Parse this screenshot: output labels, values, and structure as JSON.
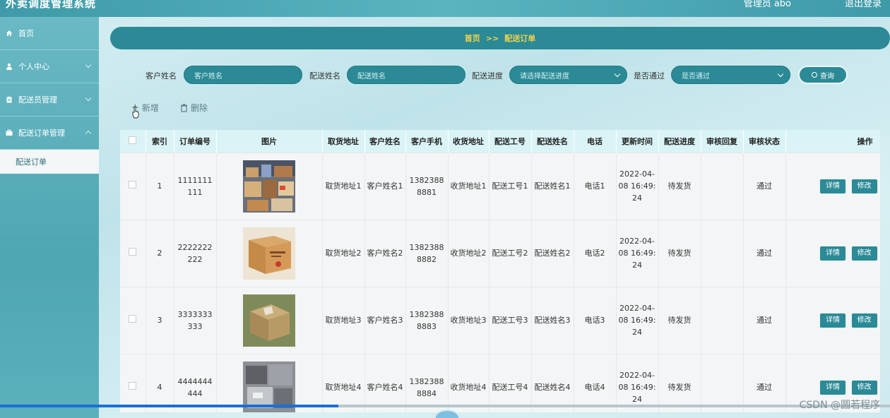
{
  "app": {
    "title": "外卖调度管理系统",
    "admin": "管理员 abo",
    "logout": "退出登录"
  },
  "sidebar": {
    "items": [
      {
        "label": "首页",
        "icon": "home-icon"
      },
      {
        "label": "个人中心",
        "icon": "user-icon"
      },
      {
        "label": "配送员管理",
        "icon": "clipboard-icon"
      },
      {
        "label": "配送订单管理",
        "icon": "briefcase-icon"
      }
    ],
    "sub": "配送订单"
  },
  "breadcrumb": {
    "home": "首页",
    "sep": ">>",
    "current": "配送订单"
  },
  "search": {
    "customer_label": "客户姓名",
    "customer_ph": "客户姓名",
    "courier_label": "配送姓名",
    "courier_ph": "配送姓名",
    "progress_label": "配送进度",
    "progress_ph": "请选择配送进度",
    "pass_label": "是否通过",
    "pass_ph": "是否通过",
    "query": "查询"
  },
  "actions": {
    "add": "新增",
    "delete": "删除"
  },
  "table": {
    "headers": [
      "",
      "索引",
      "订单编号",
      "图片",
      "取货地址",
      "客户姓名",
      "客户手机",
      "收货地址",
      "配送工号",
      "配送姓名",
      "电话",
      "更新时间",
      "配送进度",
      "审核回复",
      "审核状态",
      "操作"
    ],
    "detail": "详情",
    "edit": "修改",
    "rows": [
      {
        "idx": "1",
        "order": "1111111111",
        "pickup": "取货地址1",
        "customer": "客户姓名1",
        "phone": "13823888881",
        "delivery": "收货地址1",
        "courier_no": "配送工号1",
        "courier": "配送姓名1",
        "tel": "电话1",
        "time": "2022-04-08 16:49:24",
        "progress": "待发货",
        "reply": "",
        "status": "通过"
      },
      {
        "idx": "2",
        "order": "2222222222",
        "pickup": "取货地址2",
        "customer": "客户姓名2",
        "phone": "13823888882",
        "delivery": "收货地址2",
        "courier_no": "配送工号2",
        "courier": "配送姓名2",
        "tel": "电话2",
        "time": "2022-04-08 16:49:24",
        "progress": "待发货",
        "reply": "",
        "status": "通过"
      },
      {
        "idx": "3",
        "order": "3333333333",
        "pickup": "取货地址3",
        "customer": "客户姓名3",
        "phone": "13823888883",
        "delivery": "收货地址3",
        "courier_no": "配送工号3",
        "courier": "配送姓名3",
        "tel": "电话3",
        "time": "2022-04-08 16:49:24",
        "progress": "待发货",
        "reply": "",
        "status": "通过"
      },
      {
        "idx": "4",
        "order": "4444444444",
        "pickup": "取货地址4",
        "customer": "客户姓名4",
        "phone": "13823888884",
        "delivery": "收货地址4",
        "courier_no": "配送工号4",
        "courier": "配送姓名4",
        "tel": "电话4",
        "time": "2022-04-08 16:49:24",
        "progress": "待发货",
        "reply": "",
        "status": "通过"
      }
    ]
  },
  "watermark": "CSDN @圆若程序",
  "colors": {
    "primary": "#2b8a96",
    "crumb_text": "#f5d24b",
    "header_bg": "#daf3f6"
  }
}
